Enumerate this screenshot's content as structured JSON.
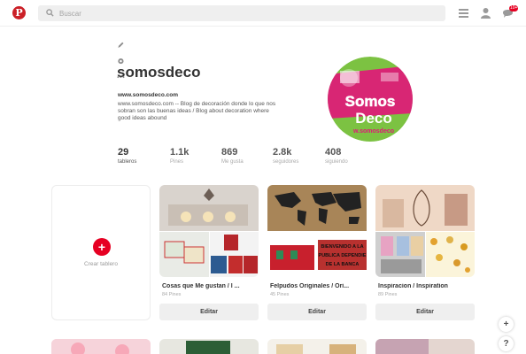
{
  "header": {
    "logo_icon": "pinterest-logo",
    "search": {
      "placeholder": "Buscar",
      "value": ""
    },
    "notifications_badge": "10+",
    "icons": [
      "menu-icon",
      "profile-icon",
      "messages-icon"
    ]
  },
  "profile": {
    "username": "somosdeco",
    "website": "www.somosdeco.com",
    "bio": "www.somosdeco.com -- Blog de decoración donde lo que nos sobran son las buenas ideas / Blog about decoration where good ideas abound",
    "avatar_text_top": "Somos",
    "avatar_text_bottom": "Deco",
    "avatar_text_url": "w.somosdeco"
  },
  "stats": [
    {
      "num": "29",
      "label": "tableros"
    },
    {
      "num": "1.1k",
      "label": "Pines"
    },
    {
      "num": "869",
      "label": "Me gusta"
    },
    {
      "num": "2.8k",
      "label": "seguidores"
    },
    {
      "num": "408",
      "label": "siguiendo"
    }
  ],
  "create_board": {
    "label": "Crear tablero"
  },
  "boards": [
    {
      "title": "Cosas que Me gustan / I ...",
      "count": "84 Pines",
      "edit": "Editar"
    },
    {
      "title": "Felpudos Originales / Ori...",
      "count": "45 Pines",
      "edit": "Editar"
    },
    {
      "title": "Inspiracion / Inspiration",
      "count": "89 Pines",
      "edit": "Editar"
    }
  ],
  "felpudo_texts": [
    "BIENVENIDO A LA",
    "PUBLICA DEPENDIE",
    "DE LA BANCA"
  ],
  "fabs": {
    "add": "+",
    "help": "?"
  },
  "colors": {
    "brand": "#e60023",
    "avatar_green": "#7cc242",
    "avatar_pink": "#e2157a"
  }
}
